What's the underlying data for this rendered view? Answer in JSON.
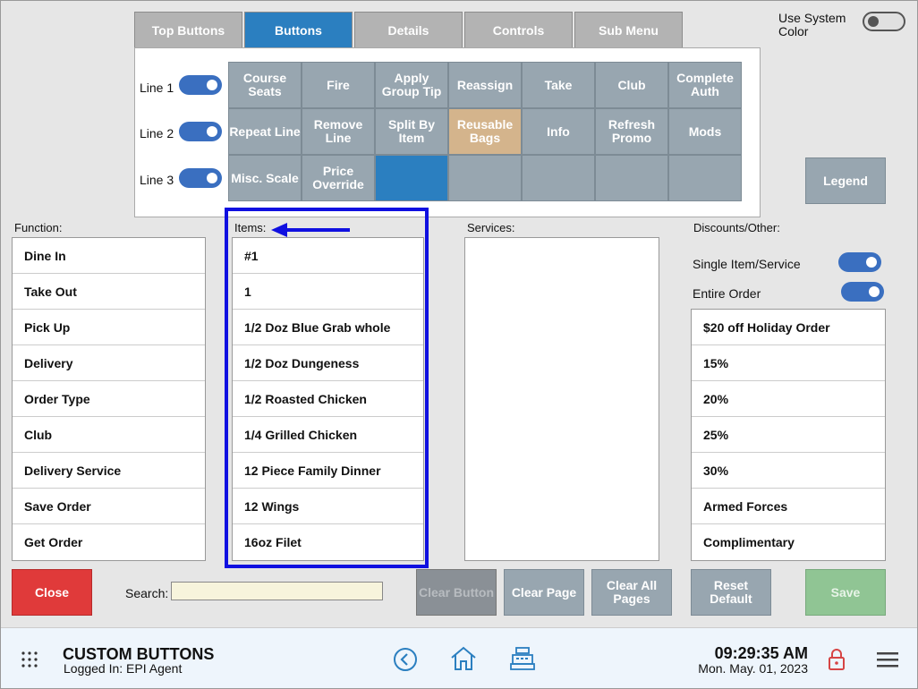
{
  "tabs": [
    "Top Buttons",
    "Buttons",
    "Details",
    "Controls",
    "Sub Menu"
  ],
  "active_tab": "Buttons",
  "system_color": {
    "label": "Use System Color",
    "on": false
  },
  "lines": [
    "Line 1",
    "Line 2",
    "Line 3"
  ],
  "grid": [
    [
      "Course Seats",
      "Fire",
      "Apply Group Tip",
      "Reassign",
      "Take",
      "Club",
      "Complete Auth"
    ],
    [
      "Repeat Line",
      "Remove Line",
      "Split By Item",
      "Reusable Bags",
      "Info",
      "Refresh Promo",
      "Mods"
    ],
    [
      "Misc. Scale",
      "Price Override",
      "",
      "",
      "",
      "",
      ""
    ]
  ],
  "legend_label": "Legend",
  "function": {
    "title": "Function:",
    "items": [
      "Dine In",
      "Take Out",
      "Pick Up",
      "Delivery",
      "Order Type",
      "Club",
      "Delivery Service",
      "Save Order",
      "Get Order"
    ]
  },
  "items": {
    "title": "Items:",
    "list": [
      "#1",
      "1",
      "1/2 Doz Blue Grab whole",
      "1/2 Doz Dungeness",
      "1/2 Roasted Chicken",
      "1/4 Grilled Chicken",
      "12 Piece Family Dinner",
      "12 Wings",
      "16oz Filet"
    ]
  },
  "services": {
    "title": "Services:"
  },
  "discounts": {
    "title": "Discounts/Other:",
    "single_label": "Single Item/Service",
    "entire_label": "Entire Order",
    "list": [
      "$20 off Holiday Order",
      "15%",
      "20%",
      "25%",
      "30%",
      "Armed Forces",
      "Complimentary"
    ]
  },
  "bottom": {
    "close": "Close",
    "search_label": "Search:",
    "search_value": "",
    "clear_button": "Clear Button",
    "clear_page": "Clear Page",
    "clear_all": "Clear All Pages",
    "reset_default": "Reset Default",
    "save": "Save"
  },
  "footer": {
    "title": "CUSTOM BUTTONS",
    "logged_in": "Logged In:  EPI Agent",
    "time": "09:29:35 AM",
    "date": "Mon. May. 01, 2023"
  },
  "colors": {
    "accent": "#2b7fc0",
    "button": "#98a6b0",
    "tan": "#d4b48c",
    "close": "#e03a3a",
    "save": "#90c594",
    "highlight": "#1010e0"
  }
}
